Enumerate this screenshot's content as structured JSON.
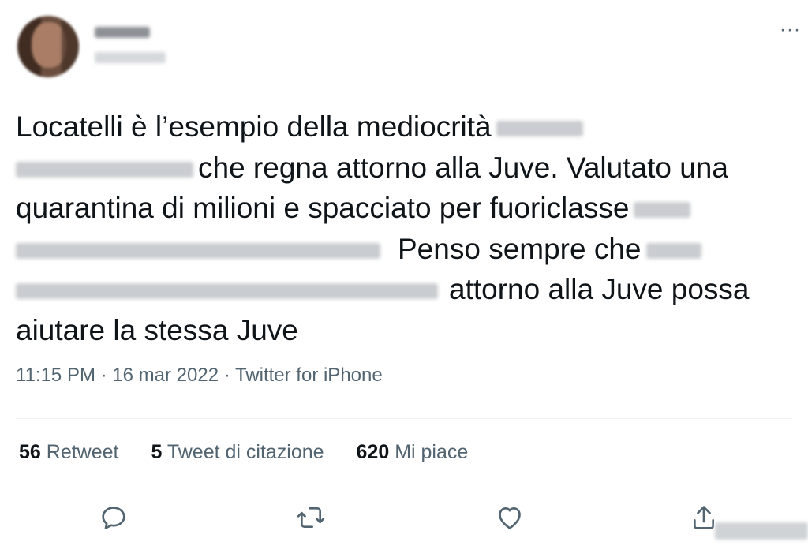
{
  "author": {
    "avatar_icon": "avatar-blurred",
    "name": "",
    "handle": ""
  },
  "more_icon_glyph": "···",
  "tweet": {
    "lines": [
      {
        "before": "Locatelli è l’esempio della mediocrità",
        "after": ""
      },
      {
        "before": "",
        "after": "che regna attorno alla Juve. Valutato una"
      },
      {
        "before": "quarantina di milioni e spacciato per fuoriclasse",
        "after": ""
      },
      {
        "before": "",
        "after": "Penso sempre che"
      },
      {
        "before": "",
        "after": "attorno alla Juve possa"
      },
      {
        "before": "aiutare la stessa Juve",
        "after": ""
      }
    ]
  },
  "meta": {
    "time": "11:15 PM",
    "sep1": " · ",
    "date": "16 mar 2022",
    "sep2": " · ",
    "source": "Twitter for iPhone"
  },
  "stats": {
    "retweets_count": "56",
    "retweets_label": "Retweet",
    "quotes_count": "5",
    "quotes_label": "Tweet di citazione",
    "likes_count": "620",
    "likes_label": "Mi piace"
  },
  "actions": {
    "reply_icon": "reply-icon",
    "retweet_icon": "retweet-icon",
    "like_icon": "heart-icon",
    "share_icon": "share-icon"
  },
  "colors": {
    "text": "#0f1419",
    "secondary": "#536471",
    "divider": "#eff3f4",
    "background": "#ffffff"
  }
}
